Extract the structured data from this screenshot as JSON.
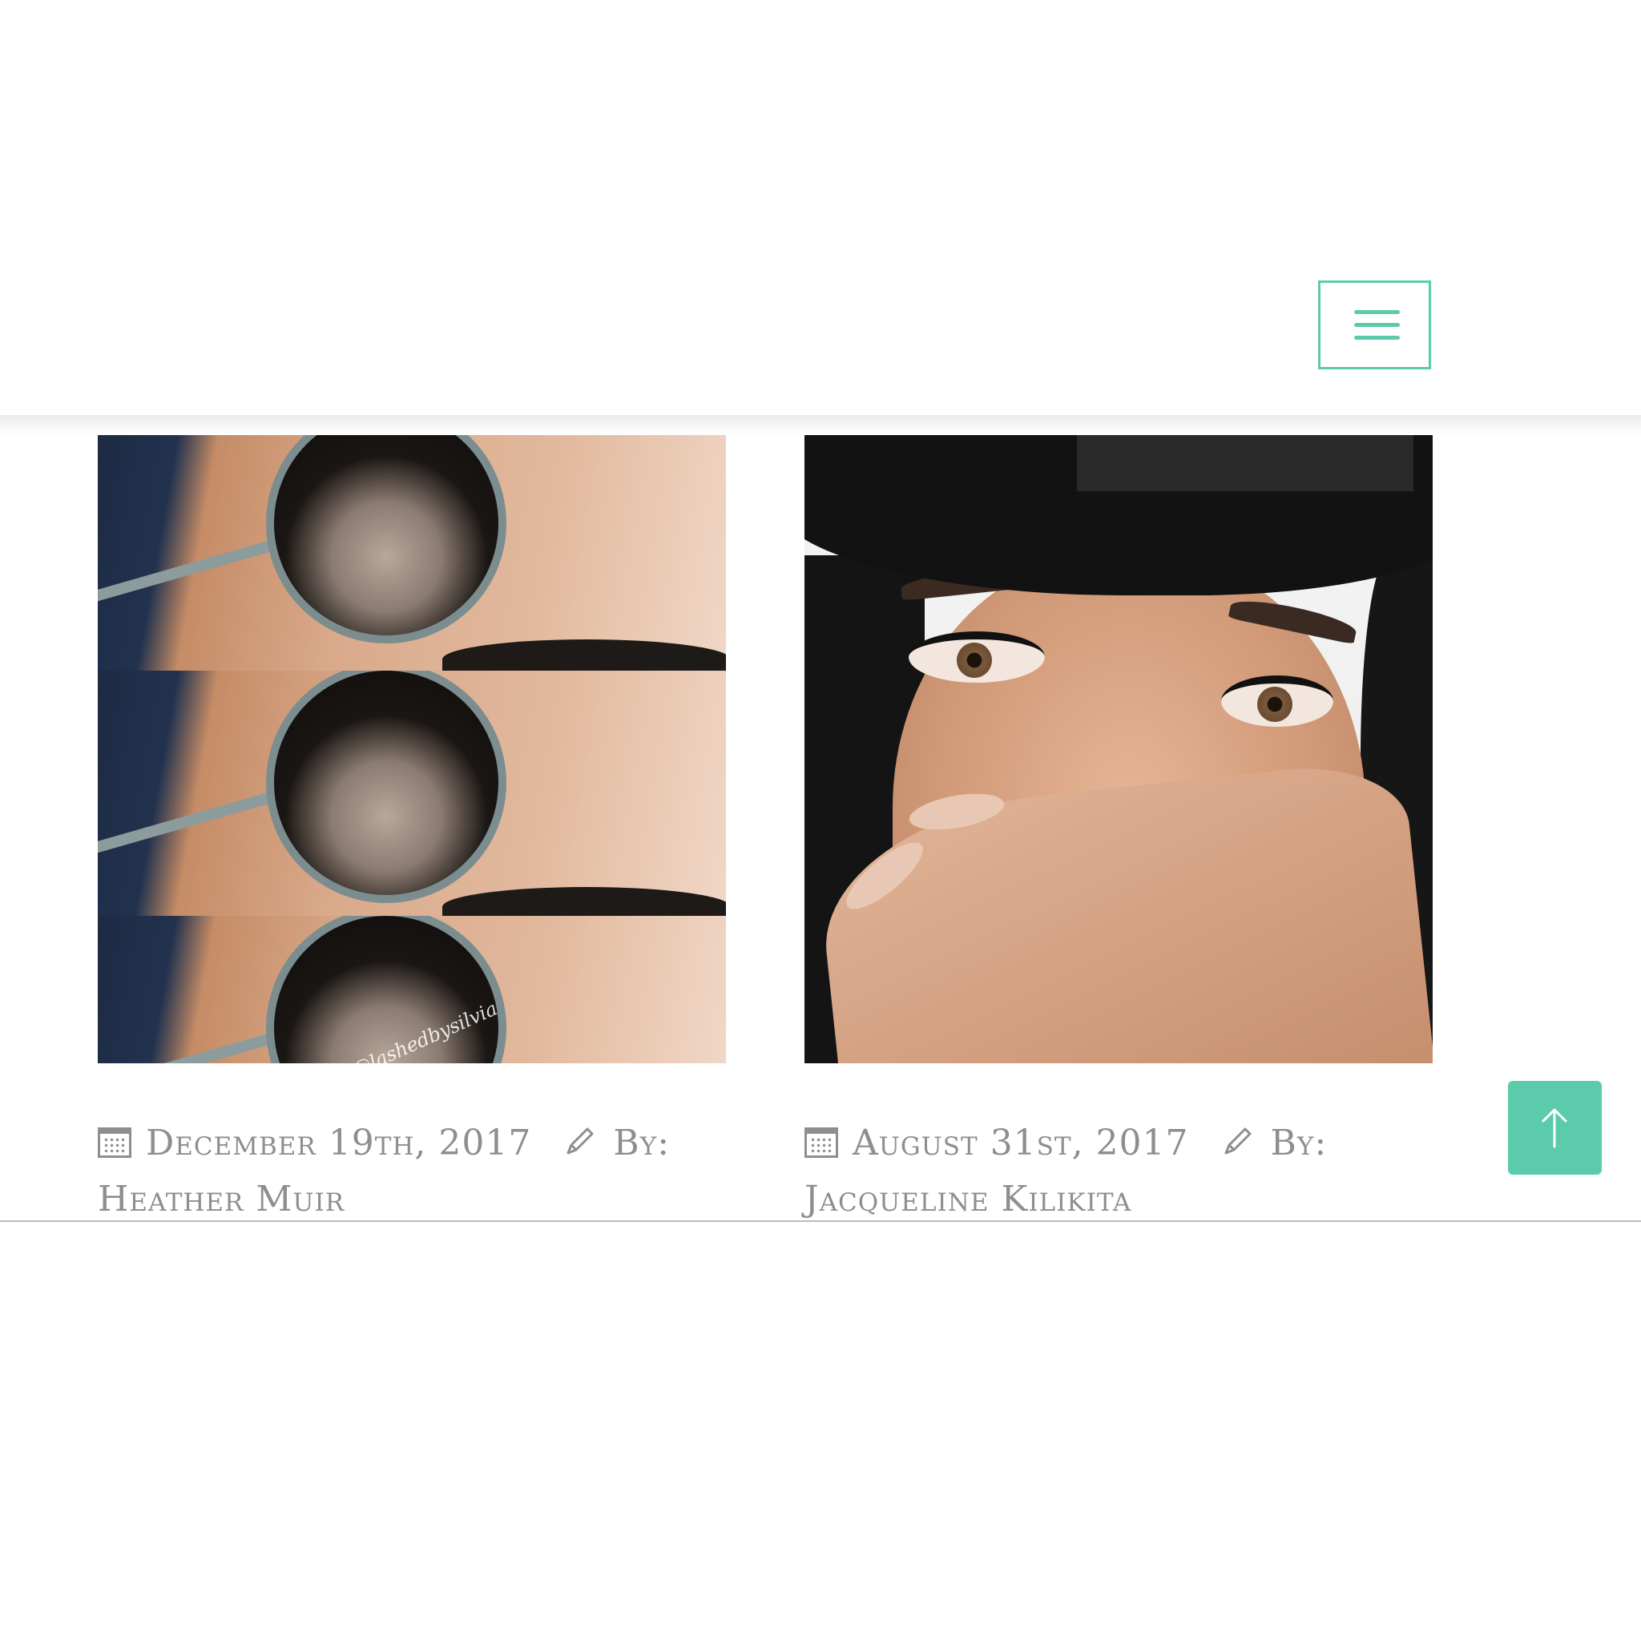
{
  "header": {
    "menu_icon": "hamburger-menu-icon",
    "accent_color": "#5ccbab"
  },
  "posts": [
    {
      "image_watermark": "@lashedbysilvia",
      "date": "December 19th, 2017",
      "by_label": "By:",
      "author": "Heather Muir",
      "date_icon": "calendar-icon",
      "author_icon": "pencil-icon"
    },
    {
      "date": "August 31st, 2017",
      "by_label": "By:",
      "author": "Jacqueline Kilikita",
      "date_icon": "calendar-icon",
      "author_icon": "pencil-icon"
    }
  ],
  "back_to_top": {
    "icon": "arrow-up-icon",
    "color": "#5ccbab"
  }
}
